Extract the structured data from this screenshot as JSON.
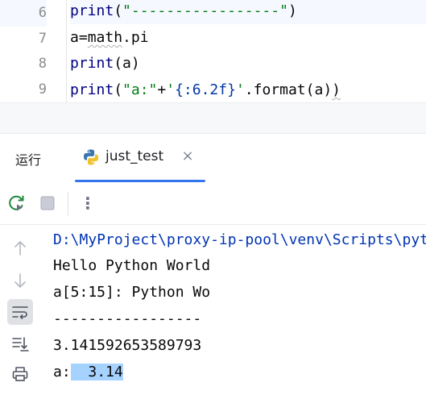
{
  "editor": {
    "lines": [
      {
        "number": "6",
        "code": "print(\"-----------------\")"
      },
      {
        "number": "7",
        "code": "a=math.pi"
      },
      {
        "number": "8",
        "code": "print(a)"
      },
      {
        "number": "9",
        "code": "print(\"a:\"+'{:6.2f}'.format(a))"
      }
    ],
    "line_fragments": {
      "l6_kw": "print",
      "l6_open": "(",
      "l6_str": "\"-----------------\"",
      "l6_close": ")",
      "l7_a": "a=",
      "l7_math": "math",
      "l7_rest": ".pi",
      "l8_kw": "print",
      "l8_rest": "(a)",
      "l9_kw": "print",
      "l9_open": "(",
      "l9_str1": "\"a:\"",
      "l9_plus": "+",
      "l9_q1": "'",
      "l9_fmt": "{:6.2f}",
      "l9_q2": "'",
      "l9_rest": ".format(a)",
      "l9_close": ")"
    }
  },
  "run_window": {
    "title": "运行",
    "tab_label": "just_test",
    "tab_icon": "python-icon",
    "close_glyph": "×",
    "more_glyph": "⋮"
  },
  "console": {
    "lines": [
      "D:\\MyProject\\proxy-ip-pool\\venv\\Scripts\\python.exe",
      "Hello Python World",
      "a[5:15]: Python Wo",
      "-----------------",
      "3.141592653589793"
    ],
    "last_prefix": "a:",
    "last_selected": "  3.14"
  },
  "colors": {
    "accent": "#3574f0",
    "selection": "#a6d2ff",
    "keyword": "#000080",
    "string": "#067d17",
    "path": "#0033b3"
  }
}
